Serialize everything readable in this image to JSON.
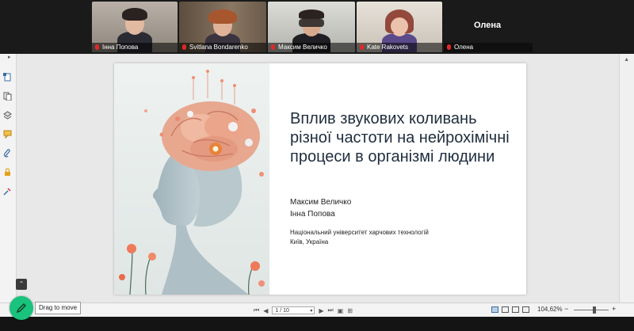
{
  "participants": [
    {
      "name": "Інна Попова",
      "active": false
    },
    {
      "name": "Svitlana Bondarenko",
      "active": false
    },
    {
      "name": "Максим Величко",
      "active": true
    },
    {
      "name": "Kate Rakovets",
      "active": false
    },
    {
      "name": "Олена",
      "active": false
    }
  ],
  "big_name": "Олена",
  "slide": {
    "title": "Вплив звукових коливань різної частоти на нейрохімічні процеси в організмі людини",
    "authors": [
      "Максим Величко",
      "Інна Попова"
    ],
    "university": "Національний університет харчових технологій",
    "city": "Київ, Україна"
  },
  "viewer": {
    "page_field": "1 / 10",
    "zoom": "104,62%"
  },
  "floating": {
    "drag_tooltip": "Drag to move"
  },
  "colors": {
    "accent_green": "#19c37d",
    "active_outline": "#3cc257",
    "mic_muted": "#e02828",
    "title_text": "#1f2d3d"
  }
}
